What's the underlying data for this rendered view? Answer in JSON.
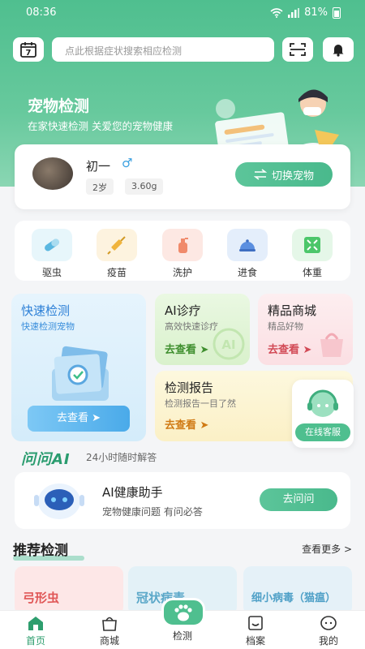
{
  "status": {
    "time": "08:36",
    "battery": "81%"
  },
  "header": {
    "search_placeholder": "点此根据症状搜索相应检测",
    "calendar_day": "7",
    "title": "宠物检测",
    "subtitle": "在家快速检测 关爱您的宠物健康"
  },
  "pet": {
    "name": "初一",
    "sex_symbol": "♂",
    "age": "2岁",
    "weight": "3.60g",
    "switch_label": "切换宠物"
  },
  "categories": [
    {
      "label": "驱虫",
      "color": "#e7f6fb"
    },
    {
      "label": "疫苗",
      "color": "#fdf3df"
    },
    {
      "label": "洗护",
      "color": "#fde8e3"
    },
    {
      "label": "进食",
      "color": "#e4eefb"
    },
    {
      "label": "体重",
      "color": "#e5f7e8"
    }
  ],
  "tiles": {
    "quick": {
      "title": "快速检测",
      "subtitle": "快速检测宠物",
      "action": "去查看 ➤"
    },
    "ai": {
      "title": "AI诊疗",
      "subtitle": "高效快速诊疗",
      "action": "去查看 ➤"
    },
    "mall": {
      "title": "精品商城",
      "subtitle": "精品好物",
      "action": "去查看 ➤"
    },
    "report": {
      "title": "检测报告",
      "subtitle": "检测报告一目了然",
      "action": "去查看 ➤"
    }
  },
  "chat_fab": {
    "label": "在线客服"
  },
  "ai_section": {
    "logo": "问问AI",
    "subtitle": "24小时随时解答"
  },
  "helper": {
    "title": "AI健康助手",
    "subtitle": "宠物健康问题 有问必答",
    "button": "去问问"
  },
  "recommend": {
    "title": "推荐检测",
    "more": "查看更多 >",
    "cards": [
      {
        "text": "弓形虫",
        "color": "#e05656",
        "bg": "#fde7e7"
      },
      {
        "text": "冠状病毒",
        "color": "#5aa7c8",
        "bg": "#e3f1f7"
      },
      {
        "text": "细小病毒（猫瘟）",
        "color": "#4fa0c7",
        "bg": "#e5f1f8"
      }
    ]
  },
  "tabbar": [
    {
      "label": "首页",
      "active": true
    },
    {
      "label": "商城"
    },
    {
      "label": "检测"
    },
    {
      "label": "档案"
    },
    {
      "label": "我的"
    }
  ],
  "colors": {
    "brand": "#4fbf8f",
    "active_tab": "#2e9e6e"
  }
}
